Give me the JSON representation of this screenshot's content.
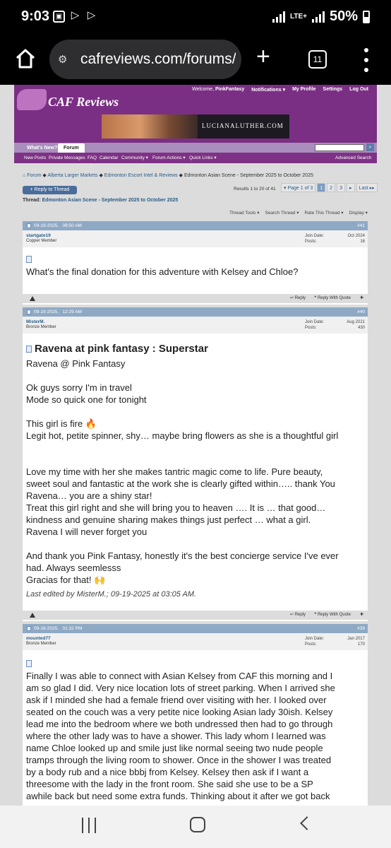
{
  "status_bar": {
    "time": "9:03",
    "network": "LTE+",
    "battery": "50%"
  },
  "browser": {
    "url": "cafreviews.com/forums/sl",
    "tab_count": "11"
  },
  "site": {
    "logo_text": "CAF Reviews",
    "welcome": "Welcome,",
    "username": "PinkFantasy",
    "top_links": [
      "Notifications ▾",
      "My Profile",
      "Settings",
      "Log Out"
    ],
    "banner_text": "LUCIANALUTHER.COM",
    "nav_tabs": [
      "What's New?",
      "Forum"
    ],
    "sub_nav": [
      "New Posts",
      "Private Messages",
      "FAQ",
      "Calendar",
      "Community ▾",
      "Forum Actions ▾",
      "Quick Links ▾",
      "Advanced Search"
    ]
  },
  "breadcrumb": [
    "Forum",
    "Alberta Larger Markets",
    "Edmonton Escort Intel & Reviews",
    "Edmonton Asian Scene - September 2025 to October 2025"
  ],
  "thread": {
    "reply_button": "+ Reply to Thread",
    "results": "Results 1 to 20 of 41",
    "pager": [
      "▾ Page 1 of 3",
      "1",
      "2",
      "3",
      "▸",
      "Last ▸▸"
    ],
    "title_label": "Thread:",
    "title": "Edmonton Asian Scene - September 2025 to October 2025",
    "tools": [
      "Thread Tools ▾",
      "Search Thread ▾",
      "Rate This Thread ▾",
      "Display ▾"
    ]
  },
  "posts": [
    {
      "date": "09-19-2025,",
      "time": "08:50 AM",
      "number": "#41",
      "username": "startgate19",
      "rank": "Copper Member",
      "join_label": "Join Date:",
      "join_date": "Oct 2024",
      "posts_label": "Posts:",
      "posts": "16",
      "body": "What's the final donation for this adventure with Kelsey and Chloe?"
    },
    {
      "date": "09-19-2025,",
      "time": "12:29 AM",
      "number": "#40",
      "username": "MisterM.",
      "rank": "Bronze Member",
      "join_label": "Join Date:",
      "join_date": "Aug 2021",
      "posts_label": "Posts:",
      "posts": "430",
      "title": "Ravena at pink fantasy : Superstar",
      "lines": [
        "Ravena @ Pink Fantasy",
        "",
        "Ok guys sorry I'm in travel",
        "Mode so quick one for tonight",
        "",
        "This girl is fire 🔥",
        "Legit hot, petite spinner, shy… maybe bring flowers as she is a thoughtful girl",
        "",
        "",
        "Love my time with her she makes tantric magic come to life. Pure beauty,",
        "sweet soul and fantastic at the work she is clearly gifted within….. thank You",
        "Ravena… you are a shiny star!",
        "Treat this girl right and she will bring you to heaven …. It is … that good…",
        "kindness and genuine sharing makes things just perfect … what a girl.",
        "Ravena I will never forget you",
        "",
        "And thank you Pink Fantasy, honestly it's the best concierge service I've ever",
        "had. Always seemlesss",
        "Gracias for that! 🙌"
      ],
      "edited": "Last edited by MisterM.; 09-19-2025 at 03:05 AM."
    },
    {
      "date": "09-18-2025,",
      "time": "01:32 PM",
      "number": "#39",
      "username": "mounted77",
      "rank": "Bronze Member",
      "join_label": "Join Date:",
      "join_date": "Jan 2017",
      "posts_label": "Posts:",
      "posts": "170",
      "lines": [
        "Finally I was able to connect with Asian Kelsey from CAF this morning and I",
        "am so glad I did. Very nice location lots of street parking. When I arrived she",
        "ask if I minded she had a female friend over visiting with her. I looked over",
        "seated on the couch was a very petite nice looking Asian lady 30ish. Kelsey",
        "lead me into the bedroom where we both undressed then had to go through",
        "where the other lady was to have a shower. This lady whom I learned was",
        "name Chloe looked up and smile just like normal seeing two nude people",
        "tramps through the living room to shower. Once in the shower I was treated",
        "by a body rub and a nice bbbj from Kelsey. Kelsey then ask if I want a",
        "threesome with the lady in the front room. She said she use to be a SP",
        "awhile back but need some extra funds. Thinking about it after we got back"
      ]
    }
  ],
  "post_footer": {
    "reply": "Reply",
    "reply_quote": "Reply With Quote"
  }
}
